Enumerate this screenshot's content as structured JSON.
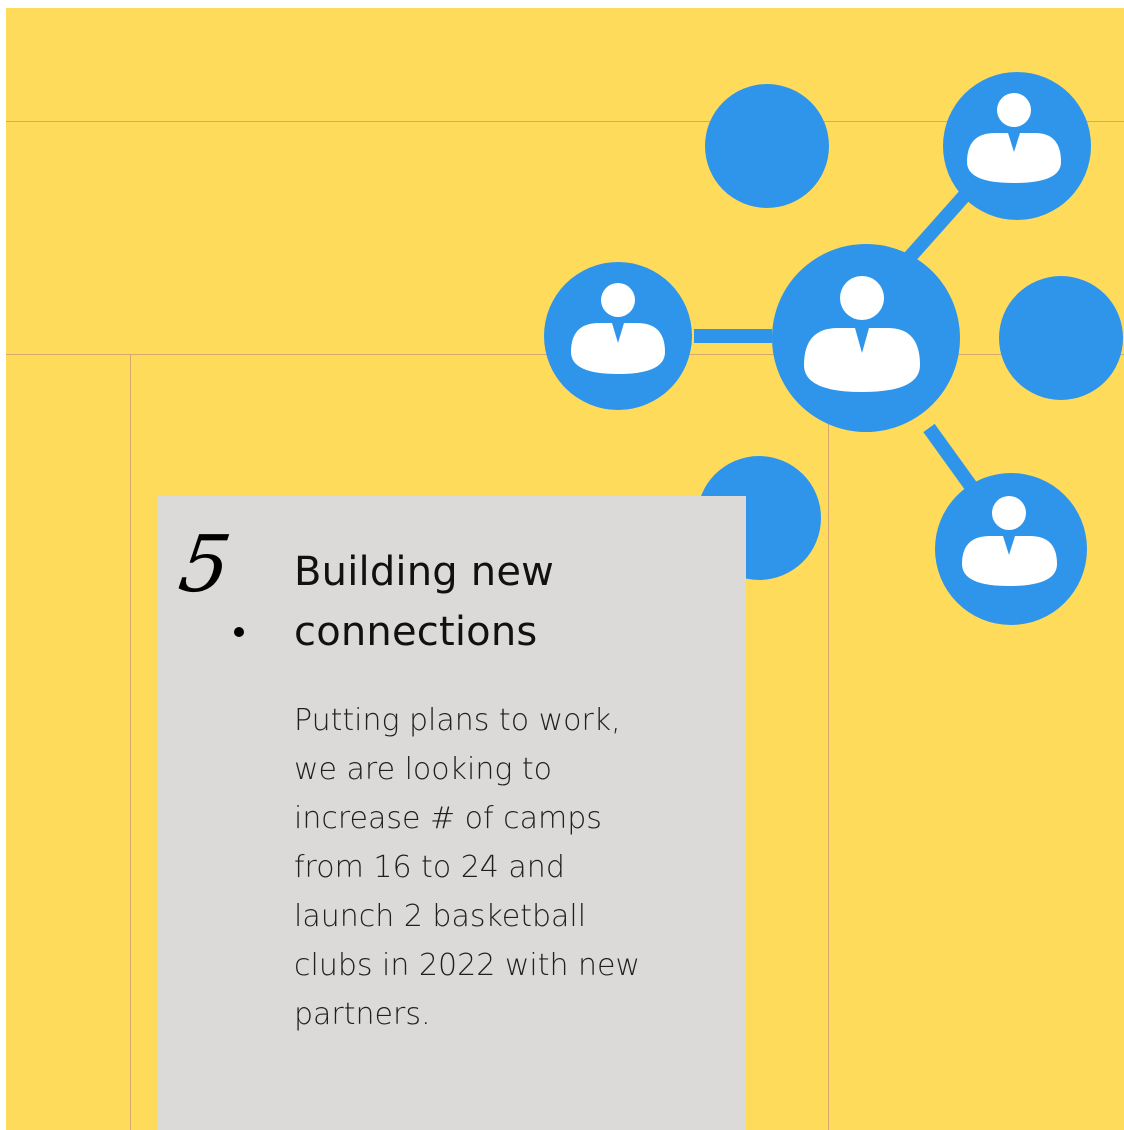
{
  "slide": {
    "background_color": "#fedb5b",
    "guide_color": "#d6a86a"
  },
  "network_graphic": {
    "color": "#2f95eb",
    "nodes": [
      {
        "name": "top-left-node",
        "icon": "circle"
      },
      {
        "name": "top-right-node",
        "icon": "person-icon"
      },
      {
        "name": "left-node",
        "icon": "person-icon"
      },
      {
        "name": "center-node",
        "icon": "person-icon"
      },
      {
        "name": "right-node",
        "icon": "circle"
      },
      {
        "name": "bottom-left-node",
        "icon": "circle"
      },
      {
        "name": "bottom-right-node",
        "icon": "person-icon"
      }
    ]
  },
  "card": {
    "background_color": "#dcdad8",
    "step_number": "5",
    "title": "Building new connections",
    "body": "Putting plans to work,\nwe are looking to\nincrease # of camps\nfrom 16 to 24 and\nlaunch 2 basketball\nclubs in 2022 with new\npartners."
  }
}
